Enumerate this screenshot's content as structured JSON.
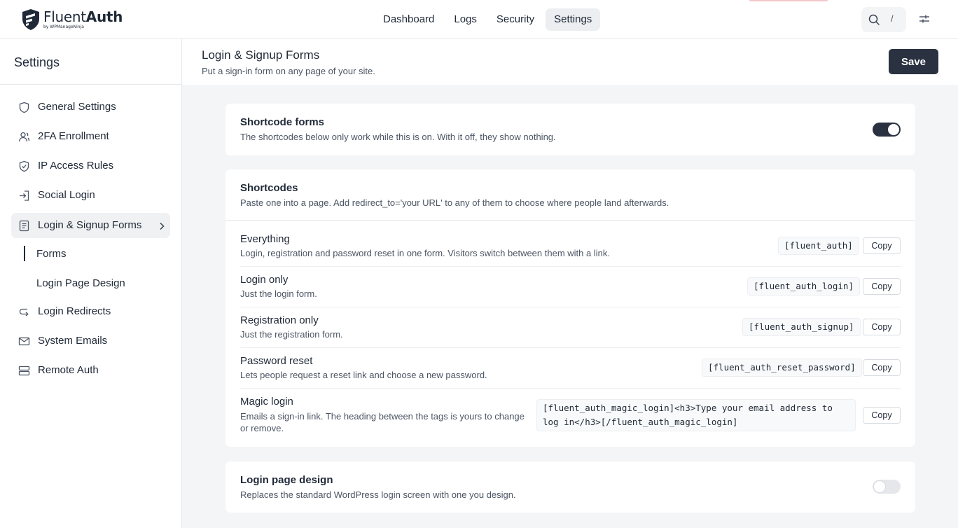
{
  "topbar": {
    "brand": {
      "name_light": "Fluent",
      "name_bold": "Auth",
      "byline": "by WPManageNinja"
    },
    "nav": [
      {
        "label": "Dashboard",
        "active": false
      },
      {
        "label": "Logs",
        "active": false
      },
      {
        "label": "Security",
        "active": false
      },
      {
        "label": "Settings",
        "active": true
      }
    ],
    "search_shortcut": "/",
    "icons": {
      "search": "search-icon",
      "settings": "sliders-icon"
    }
  },
  "sidebar": {
    "title": "Settings",
    "items": [
      {
        "label": "General Settings",
        "icon": "shield-icon"
      },
      {
        "label": "2FA Enrollment",
        "icon": "user-icon"
      },
      {
        "label": "IP Access Rules",
        "icon": "shield-check-icon"
      },
      {
        "label": "Social Login",
        "icon": "login-arrow-icon"
      },
      {
        "label": "Login & Signup Forms",
        "icon": "document-icon",
        "active": true
      },
      {
        "label": "Login Redirects",
        "icon": "redirect-icon"
      },
      {
        "label": "System Emails",
        "icon": "envelope-icon"
      },
      {
        "label": "Remote Auth",
        "icon": "server-icon"
      }
    ],
    "subitems": [
      {
        "label": "Forms",
        "active": true
      },
      {
        "label": "Login Page Design",
        "active": false
      }
    ]
  },
  "header": {
    "title": "Login & Signup Forms",
    "subtitle": "Put a sign-in form on any page of your site.",
    "save_label": "Save"
  },
  "shortcode_forms": {
    "title": "Shortcode forms",
    "desc": "The shortcodes below only work while this is on. With it off, they show nothing.",
    "enabled": true
  },
  "shortcodes": {
    "title": "Shortcodes",
    "desc": "Paste one into a page. Add redirect_to='your URL' to any of them to choose where people land afterwards.",
    "copy_label": "Copy",
    "rows": [
      {
        "title": "Everything",
        "desc": "Login, registration and password reset in one form. Visitors switch between them with a link.",
        "code": "[fluent_auth]"
      },
      {
        "title": "Login only",
        "desc": "Just the login form.",
        "code": "[fluent_auth_login]"
      },
      {
        "title": "Registration only",
        "desc": "Just the registration form.",
        "code": "[fluent_auth_signup]"
      },
      {
        "title": "Password reset",
        "desc": "Lets people request a reset link and choose a new password.",
        "code": "[fluent_auth_reset_password]"
      },
      {
        "title": "Magic login",
        "desc": "Emails a sign-in link. The heading between the tags is yours to change or remove.",
        "code": "[fluent_auth_magic_login]<h3>Type your email address to log in</h3>[/fluent_auth_magic_login]"
      }
    ]
  },
  "login_page_design": {
    "title": "Login page design",
    "desc": "Replaces the standard WordPress login screen with one you design.",
    "enabled": false
  },
  "colors": {
    "accent_dark": "#2a3140",
    "background": "#f4f5f7",
    "card": "#ffffff"
  }
}
